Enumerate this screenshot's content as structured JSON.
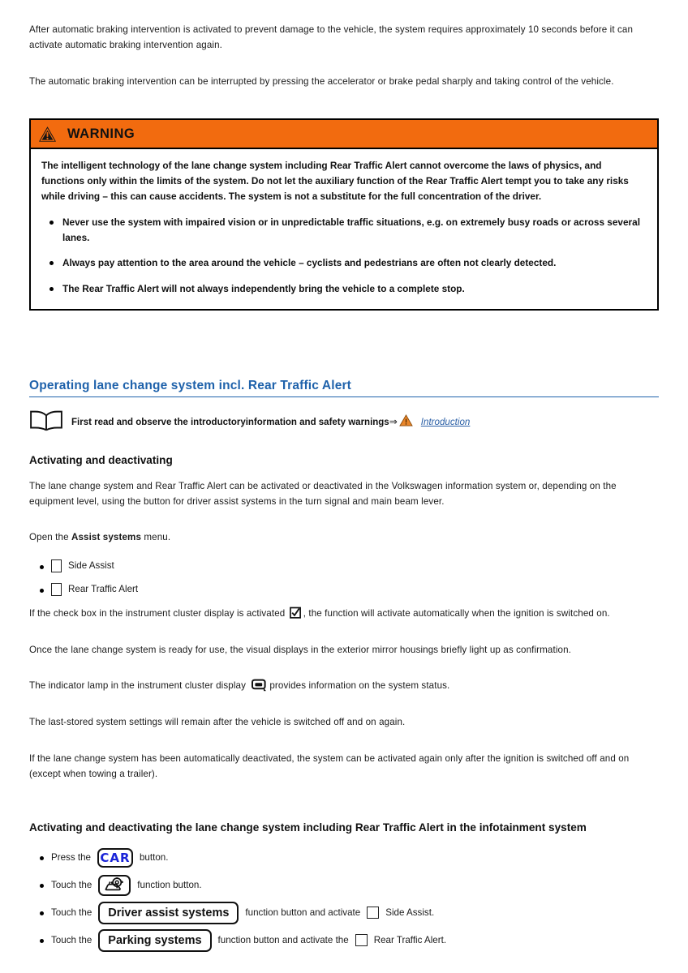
{
  "intro_paragraphs": [
    "After automatic braking intervention is activated to prevent damage to the vehicle, the system requires approximately 10 seconds before it can activate automatic braking intervention again.",
    "The automatic braking intervention can be interrupted by pressing the accelerator or brake pedal sharply and taking control of the vehicle."
  ],
  "warning": {
    "title": "WARNING",
    "accent_color": "#f26b0f",
    "body": "The intelligent technology of the lane change system including Rear Traffic Alert cannot overcome the laws of physics, and functions only within the limits of the system. Do not let the auxiliary function of the Rear Traffic Alert tempt you to take any risks while driving – this can cause accidents. The system is not a substitute for the full concentration of the driver.",
    "bullets": [
      "Never use the system with impaired vision or in unpredictable traffic situations, e.g. on extremely busy roads or across several lanes.",
      "Always pay attention to the area around the vehicle – cyclists and pedestrians are often not clearly detected.",
      "The Rear Traffic Alert will not always independently bring the vehicle to a complete stop."
    ]
  },
  "section": {
    "heading": "Operating lane change system incl. Rear Traffic Alert",
    "heading_color": "#1f62ab",
    "note": {
      "text": "First read and observe the introductoryinformation and safety warnings",
      "arrow": "⇒",
      "link": "Introduction"
    }
  },
  "activating": {
    "heading": "Activating and deactivating",
    "paragraph_1": "The lane change system and Rear Traffic Alert can be activated or deactivated in the Volkswagen information system or, depending on the equipment level, using the button for driver assist systems in the turn signal and main beam lever.",
    "open_menu_prefix": "Open the ",
    "open_menu_bold": "Assist systems",
    "open_menu_suffix": " menu.",
    "options": [
      "Side Assist",
      "Rear Traffic Alert"
    ],
    "checkbox_note_before": "If the check box in the instrument cluster display is activated",
    "checkbox_note_after": ", the function will activate automatically when the ignition is switched on.",
    "paragraph_2": "Once the lane change system is ready for use, the visual displays in the exterior mirror housings briefly light up as confirmation.",
    "lamp_note_before": "The indicator lamp in the instrument cluster display",
    "lamp_note_after": "provides information on the system status.",
    "paragraph_3": "The last-stored system settings will remain after the vehicle is switched off and on again.",
    "paragraph_4": "If the lane change system has been automatically deactivated, the system can be activated again only after the ignition is switched off and on (except when towing a trailer)."
  },
  "infotainment": {
    "heading": "Activating and deactivating the lane change system including Rear Traffic Alert in the infotainment system",
    "steps": [
      {
        "prefix": "Press the",
        "button_label": "CAR",
        "button_kind": "car-text",
        "suffix": "button.",
        "tail_checkbox": false,
        "tail_label": ""
      },
      {
        "prefix": "Touch the",
        "button_label": "",
        "button_kind": "car-settings-icon",
        "suffix": "function button.",
        "tail_checkbox": false,
        "tail_label": ""
      },
      {
        "prefix": "Touch the",
        "button_label": "Driver assist systems",
        "button_kind": "text",
        "suffix": "function button and activate",
        "tail_checkbox": true,
        "tail_label": "Side Assist."
      },
      {
        "prefix": "Touch the",
        "button_label": "Parking systems",
        "button_kind": "text",
        "suffix": "function button and activate the",
        "tail_checkbox": true,
        "tail_label": "Rear Traffic Alert."
      }
    ]
  }
}
